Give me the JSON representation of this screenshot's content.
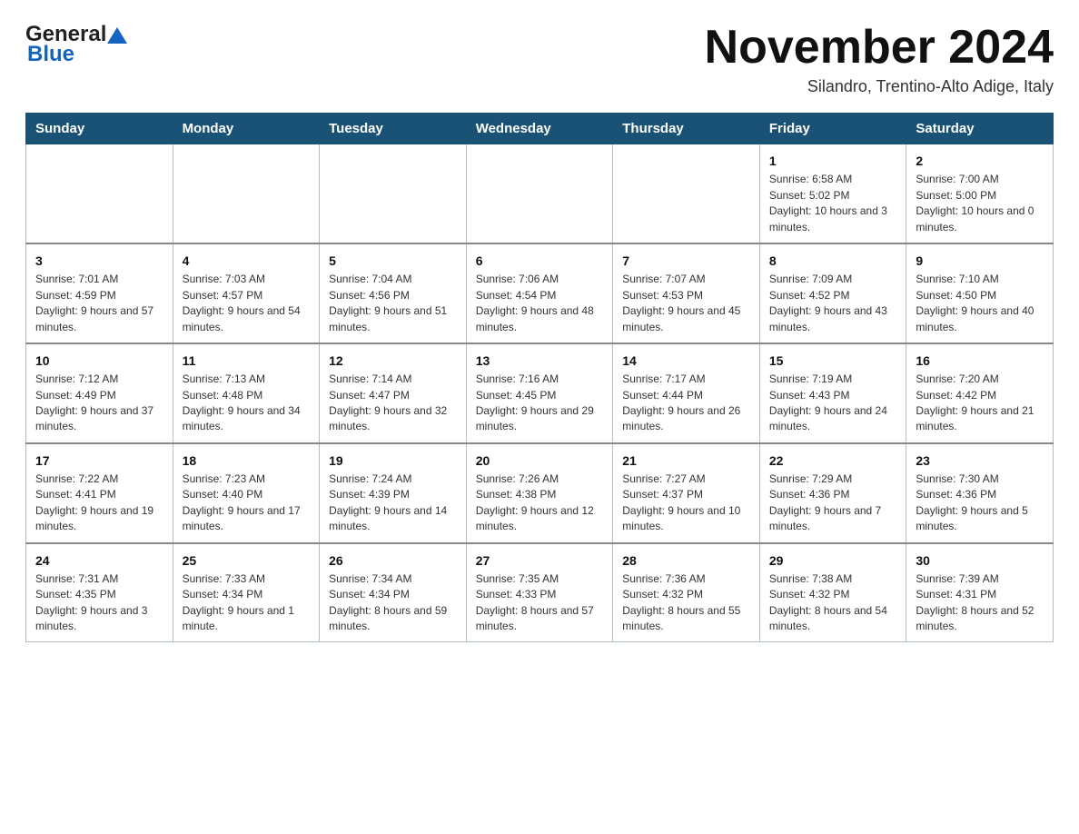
{
  "header": {
    "logo_general": "General",
    "logo_blue": "Blue",
    "month_title": "November 2024",
    "subtitle": "Silandro, Trentino-Alto Adige, Italy"
  },
  "days_of_week": [
    "Sunday",
    "Monday",
    "Tuesday",
    "Wednesday",
    "Thursday",
    "Friday",
    "Saturday"
  ],
  "weeks": [
    [
      {
        "num": "",
        "info": ""
      },
      {
        "num": "",
        "info": ""
      },
      {
        "num": "",
        "info": ""
      },
      {
        "num": "",
        "info": ""
      },
      {
        "num": "",
        "info": ""
      },
      {
        "num": "1",
        "info": "Sunrise: 6:58 AM\nSunset: 5:02 PM\nDaylight: 10 hours and 3 minutes."
      },
      {
        "num": "2",
        "info": "Sunrise: 7:00 AM\nSunset: 5:00 PM\nDaylight: 10 hours and 0 minutes."
      }
    ],
    [
      {
        "num": "3",
        "info": "Sunrise: 7:01 AM\nSunset: 4:59 PM\nDaylight: 9 hours and 57 minutes."
      },
      {
        "num": "4",
        "info": "Sunrise: 7:03 AM\nSunset: 4:57 PM\nDaylight: 9 hours and 54 minutes."
      },
      {
        "num": "5",
        "info": "Sunrise: 7:04 AM\nSunset: 4:56 PM\nDaylight: 9 hours and 51 minutes."
      },
      {
        "num": "6",
        "info": "Sunrise: 7:06 AM\nSunset: 4:54 PM\nDaylight: 9 hours and 48 minutes."
      },
      {
        "num": "7",
        "info": "Sunrise: 7:07 AM\nSunset: 4:53 PM\nDaylight: 9 hours and 45 minutes."
      },
      {
        "num": "8",
        "info": "Sunrise: 7:09 AM\nSunset: 4:52 PM\nDaylight: 9 hours and 43 minutes."
      },
      {
        "num": "9",
        "info": "Sunrise: 7:10 AM\nSunset: 4:50 PM\nDaylight: 9 hours and 40 minutes."
      }
    ],
    [
      {
        "num": "10",
        "info": "Sunrise: 7:12 AM\nSunset: 4:49 PM\nDaylight: 9 hours and 37 minutes."
      },
      {
        "num": "11",
        "info": "Sunrise: 7:13 AM\nSunset: 4:48 PM\nDaylight: 9 hours and 34 minutes."
      },
      {
        "num": "12",
        "info": "Sunrise: 7:14 AM\nSunset: 4:47 PM\nDaylight: 9 hours and 32 minutes."
      },
      {
        "num": "13",
        "info": "Sunrise: 7:16 AM\nSunset: 4:45 PM\nDaylight: 9 hours and 29 minutes."
      },
      {
        "num": "14",
        "info": "Sunrise: 7:17 AM\nSunset: 4:44 PM\nDaylight: 9 hours and 26 minutes."
      },
      {
        "num": "15",
        "info": "Sunrise: 7:19 AM\nSunset: 4:43 PM\nDaylight: 9 hours and 24 minutes."
      },
      {
        "num": "16",
        "info": "Sunrise: 7:20 AM\nSunset: 4:42 PM\nDaylight: 9 hours and 21 minutes."
      }
    ],
    [
      {
        "num": "17",
        "info": "Sunrise: 7:22 AM\nSunset: 4:41 PM\nDaylight: 9 hours and 19 minutes."
      },
      {
        "num": "18",
        "info": "Sunrise: 7:23 AM\nSunset: 4:40 PM\nDaylight: 9 hours and 17 minutes."
      },
      {
        "num": "19",
        "info": "Sunrise: 7:24 AM\nSunset: 4:39 PM\nDaylight: 9 hours and 14 minutes."
      },
      {
        "num": "20",
        "info": "Sunrise: 7:26 AM\nSunset: 4:38 PM\nDaylight: 9 hours and 12 minutes."
      },
      {
        "num": "21",
        "info": "Sunrise: 7:27 AM\nSunset: 4:37 PM\nDaylight: 9 hours and 10 minutes."
      },
      {
        "num": "22",
        "info": "Sunrise: 7:29 AM\nSunset: 4:36 PM\nDaylight: 9 hours and 7 minutes."
      },
      {
        "num": "23",
        "info": "Sunrise: 7:30 AM\nSunset: 4:36 PM\nDaylight: 9 hours and 5 minutes."
      }
    ],
    [
      {
        "num": "24",
        "info": "Sunrise: 7:31 AM\nSunset: 4:35 PM\nDaylight: 9 hours and 3 minutes."
      },
      {
        "num": "25",
        "info": "Sunrise: 7:33 AM\nSunset: 4:34 PM\nDaylight: 9 hours and 1 minute."
      },
      {
        "num": "26",
        "info": "Sunrise: 7:34 AM\nSunset: 4:34 PM\nDaylight: 8 hours and 59 minutes."
      },
      {
        "num": "27",
        "info": "Sunrise: 7:35 AM\nSunset: 4:33 PM\nDaylight: 8 hours and 57 minutes."
      },
      {
        "num": "28",
        "info": "Sunrise: 7:36 AM\nSunset: 4:32 PM\nDaylight: 8 hours and 55 minutes."
      },
      {
        "num": "29",
        "info": "Sunrise: 7:38 AM\nSunset: 4:32 PM\nDaylight: 8 hours and 54 minutes."
      },
      {
        "num": "30",
        "info": "Sunrise: 7:39 AM\nSunset: 4:31 PM\nDaylight: 8 hours and 52 minutes."
      }
    ]
  ]
}
